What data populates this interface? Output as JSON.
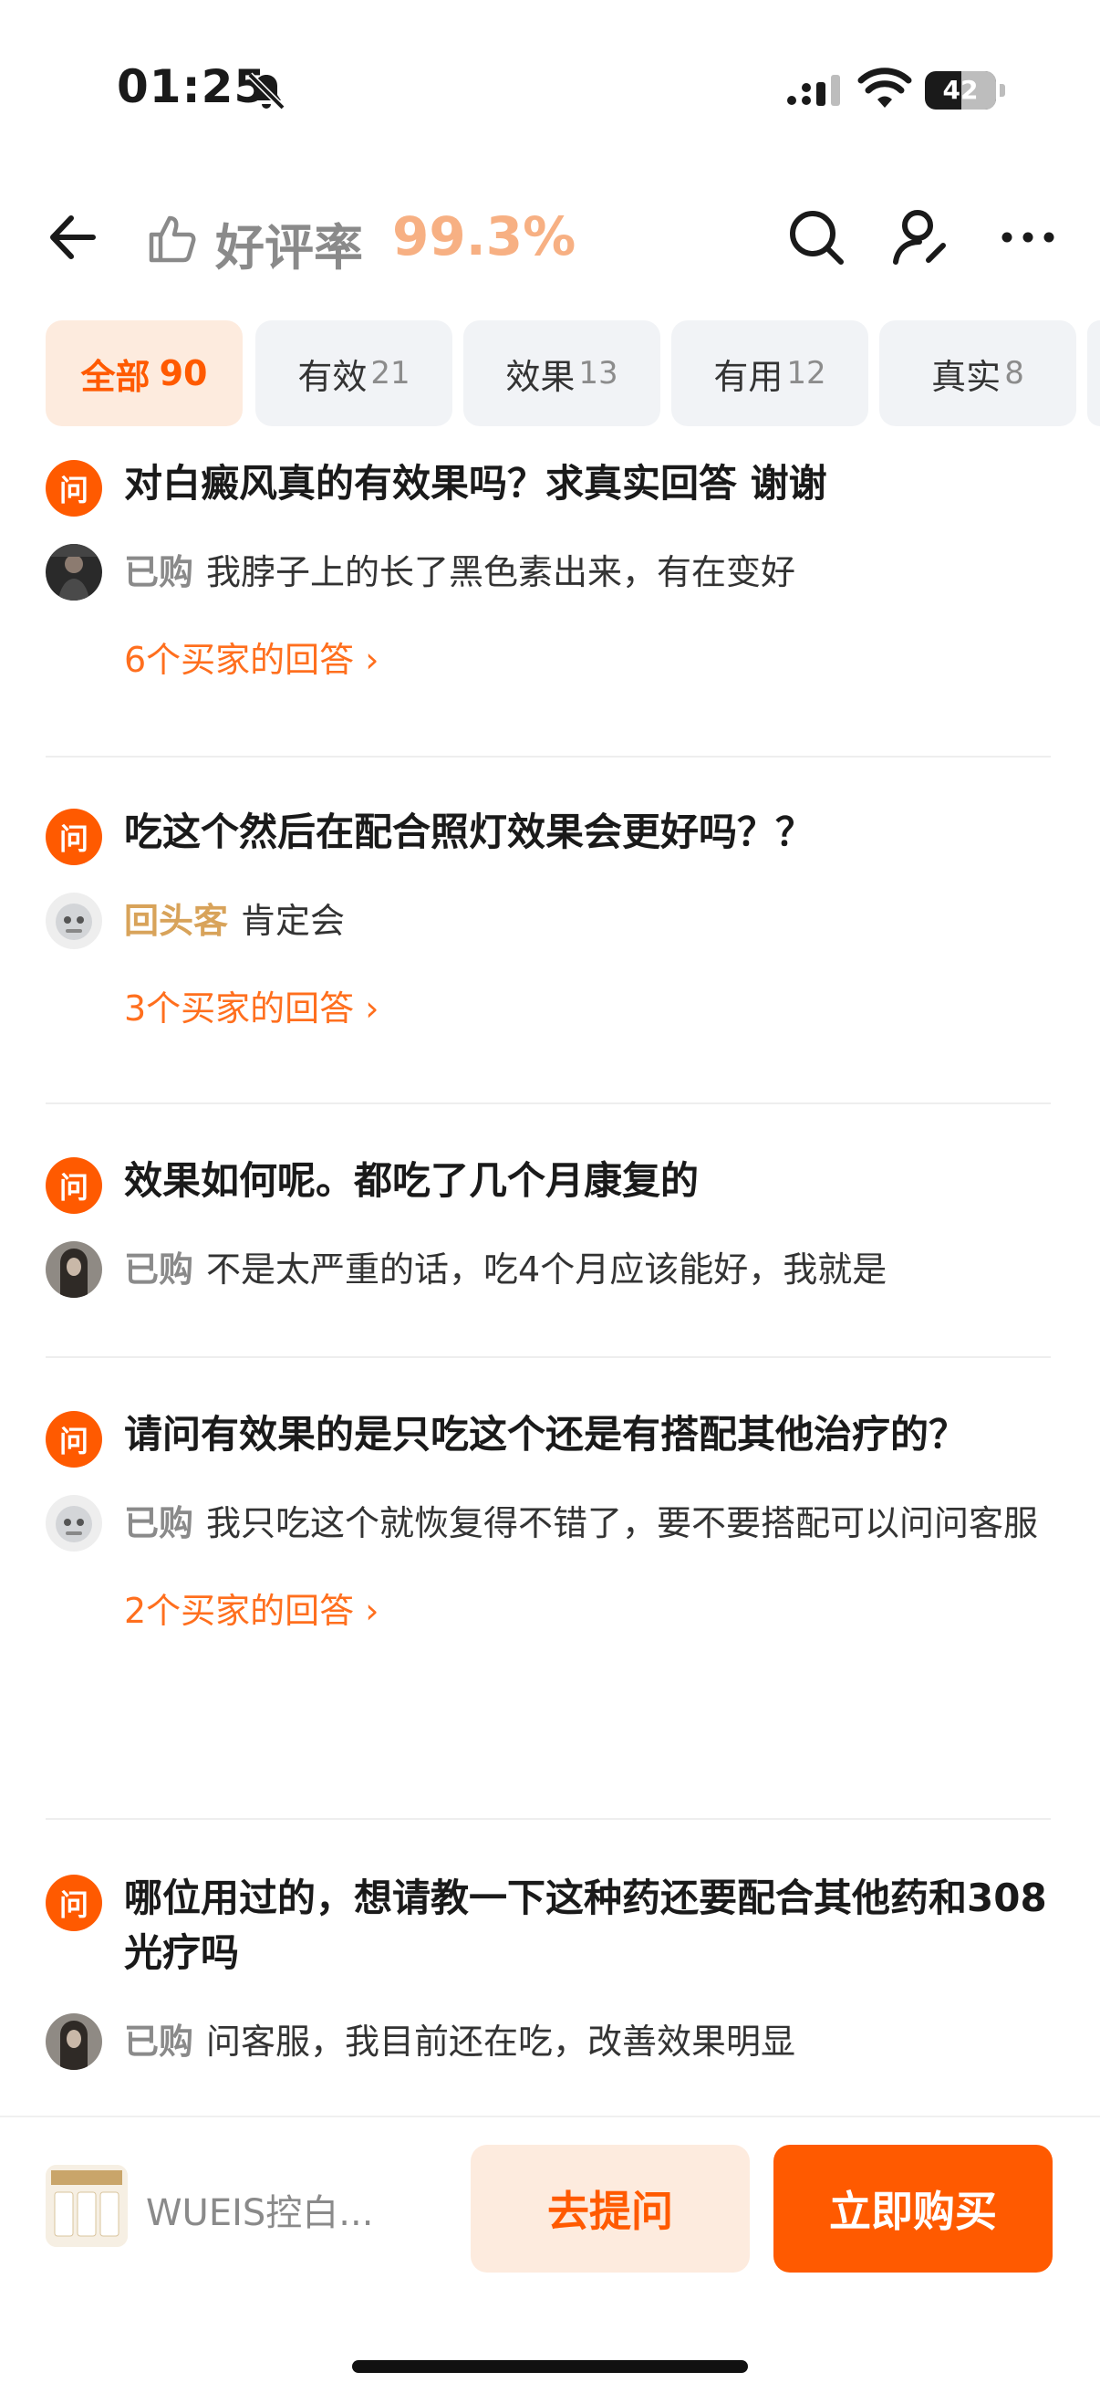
{
  "status": {
    "time": "01:25",
    "battery": "42"
  },
  "header": {
    "rating_label": "好评率",
    "rating_value": "99.3%"
  },
  "tabs": [
    {
      "label": "全部",
      "count": "90",
      "active": true
    },
    {
      "label": "有效",
      "count": "21"
    },
    {
      "label": "效果",
      "count": "13"
    },
    {
      "label": "有用",
      "count": "12"
    },
    {
      "label": "真实",
      "count": "8"
    }
  ],
  "questions": [
    {
      "badge": "问",
      "text": "对白癜风真的有效果吗？求真实回答 谢谢",
      "answer_tag": "已购",
      "answer": "我脖子上的长了黑色素出来，有在变好",
      "more": "6个买家的回答"
    },
    {
      "badge": "问",
      "text": "吃这个然后在配合照灯效果会更好吗？？",
      "answer_tag": "回头客",
      "answer": "肯定会",
      "more": "3个买家的回答"
    },
    {
      "badge": "问",
      "text": "效果如何呢。都吃了几个月康复的",
      "answer_tag": "已购",
      "answer": "不是太严重的话，吃4个月应该能好，我就是"
    },
    {
      "badge": "问",
      "text": "请问有效果的是只吃这个还是有搭配其他治疗的？",
      "answer_tag": "已购",
      "answer": "我只吃这个就恢复得不错了，要不要搭配可以问问客服",
      "more": "2个买家的回答"
    },
    {
      "badge": "问",
      "text": "哪位用过的，想请教一下这种药还要配合其他药和308光疗吗",
      "answer_tag": "已购",
      "answer": "问客服，我目前还在吃，改善效果明显"
    }
  ],
  "bottom": {
    "product_name": "WUEIS控白...",
    "ask_label": "去提问",
    "buy_label": "立即购买"
  },
  "colors": {
    "accent": "#ff5a00",
    "rating": "#f7b083",
    "returning_tag": "#d8a35a"
  }
}
